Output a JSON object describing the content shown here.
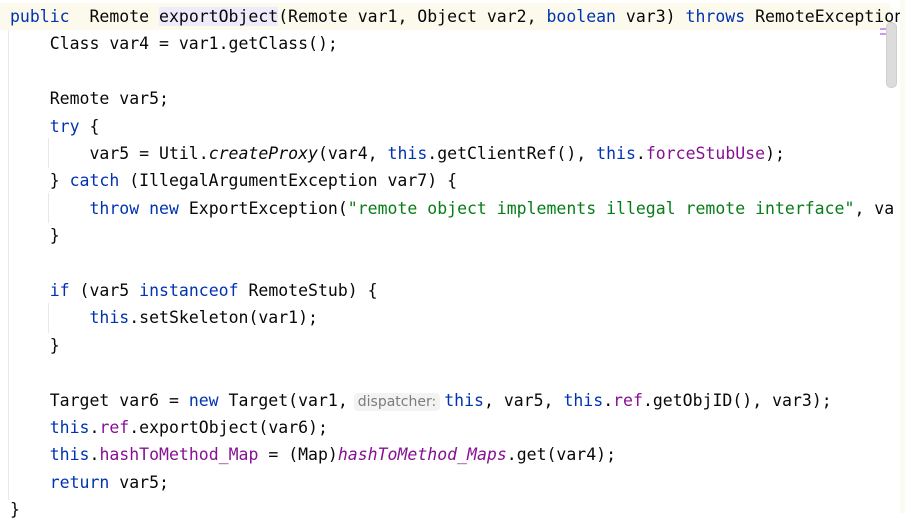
{
  "editor": {
    "language": "java",
    "colors": {
      "keyword": "#0033b3",
      "field": "#871094",
      "string": "#067d17",
      "current_line": "#fcfaed",
      "highlight": "#edebfc"
    },
    "lines": [
      [
        [
          "kw",
          "public"
        ],
        [
          "",
          "  Remote "
        ],
        [
          "hl",
          "exportObject"
        ],
        [
          "",
          "(Remote var1, Object var2, "
        ],
        [
          "kw",
          "boolean"
        ],
        [
          "",
          "",
          " var3) "
        ],
        [
          "kw",
          "throws"
        ],
        [
          "",
          " RemoteException"
        ]
      ],
      [
        [
          "",
          "    Class var4 = var1.getClass();"
        ]
      ],
      [
        [
          "",
          ""
        ]
      ],
      [
        [
          "",
          "    Remote var5;"
        ]
      ],
      [
        [
          "",
          "    "
        ],
        [
          "kw",
          "try"
        ],
        [
          "",
          " {"
        ]
      ],
      [
        [
          "",
          "        var5 = Util."
        ],
        [
          "it",
          "createProxy"
        ],
        [
          "",
          "(var4, "
        ],
        [
          "kw",
          "this"
        ],
        [
          "",
          ".getClientRef(), "
        ],
        [
          "kw",
          "this"
        ],
        [
          "",
          "."
        ],
        [
          "fld",
          "forceStubUse"
        ],
        [
          "",
          ");"
        ]
      ],
      [
        [
          "",
          "    } "
        ],
        [
          "kw",
          "catch"
        ],
        [
          "",
          " (IllegalArgumentException var7) {"
        ]
      ],
      [
        [
          "",
          "        "
        ],
        [
          "kw",
          "throw"
        ],
        [
          "",
          " "
        ],
        [
          "kw",
          "new"
        ],
        [
          "",
          " ExportException("
        ],
        [
          "str",
          "\"remote object implements illegal remote interface\""
        ],
        [
          "",
          ", va"
        ]
      ],
      [
        [
          "",
          "    }"
        ]
      ],
      [
        [
          "",
          ""
        ]
      ],
      [
        [
          "",
          "    "
        ],
        [
          "kw",
          "if"
        ],
        [
          "",
          " (var5 "
        ],
        [
          "kw",
          "instanceof"
        ],
        [
          "",
          " RemoteStub) {"
        ]
      ],
      [
        [
          "",
          "        "
        ],
        [
          "kw",
          "this"
        ],
        [
          "",
          ".setSkeleton(var1);"
        ]
      ],
      [
        [
          "",
          "    }"
        ]
      ],
      [
        [
          "",
          ""
        ]
      ],
      [
        [
          "",
          "    Target var6 = "
        ],
        [
          "kw",
          "new"
        ],
        [
          "",
          " Target(var1,"
        ],
        [
          "hint",
          "dispatcher:"
        ],
        [
          "kw",
          "this"
        ],
        [
          "",
          ", var5, "
        ],
        [
          "kw",
          "this"
        ],
        [
          "",
          "."
        ],
        [
          "fld",
          "ref"
        ],
        [
          "",
          ".getObjID(), var3);"
        ]
      ],
      [
        [
          "",
          "    "
        ],
        [
          "kw",
          "this"
        ],
        [
          "",
          "."
        ],
        [
          "fld",
          "ref"
        ],
        [
          "",
          ".exportObject(var6);"
        ]
      ],
      [
        [
          "",
          "    "
        ],
        [
          "kw",
          "this"
        ],
        [
          "",
          "."
        ],
        [
          "fld",
          "hashToMethod_Map"
        ],
        [
          "",
          "",
          " = (Map)"
        ],
        [
          "st",
          "hashToMethod_Maps"
        ],
        [
          "",
          ".get(var4);"
        ]
      ],
      [
        [
          "",
          "    "
        ],
        [
          "kw",
          "return"
        ],
        [
          "",
          " var5;"
        ]
      ],
      [
        [
          "",
          "}"
        ]
      ]
    ]
  }
}
